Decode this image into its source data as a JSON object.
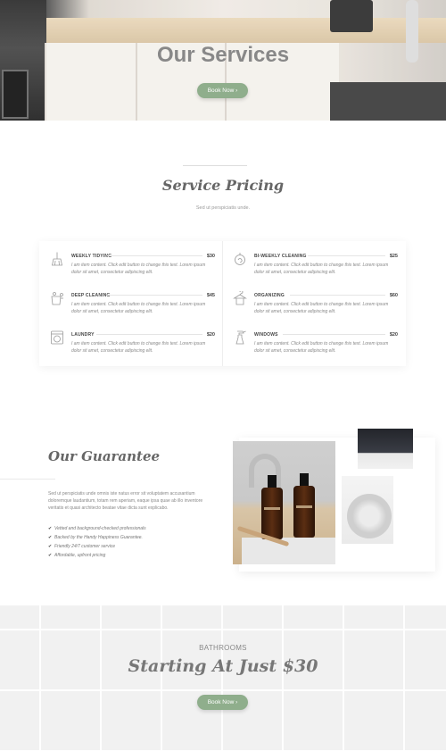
{
  "hero": {
    "title": "Our Services",
    "button_label": "Book Now  ›"
  },
  "pricing": {
    "title": "Service Pricing",
    "subtitle": "Sed ut perspiciatis unde.",
    "items": [
      {
        "name": "WEEKLY TIDYING",
        "price": "$30",
        "icon": "broom-icon",
        "desc": "I am item content. Click edit button to change this text. Lorem ipsum dolor sit amet, consectetur adipiscing elit."
      },
      {
        "name": "BI-WEEKLY CLEANING",
        "price": "$25",
        "icon": "cleaning-spray-icon",
        "desc": "I am item content. Click edit button to change this text. Lorem ipsum dolor sit amet, consectetur adipiscing elit."
      },
      {
        "name": "DEEP CLEANING",
        "price": "$45",
        "icon": "bucket-icon",
        "desc": "I am item content. Click edit button to change this text. Lorem ipsum dolor sit amet, consectetur adipiscing elit."
      },
      {
        "name": "ORGANIZING",
        "price": "$60",
        "icon": "hanger-shirt-icon",
        "desc": "I am item content. Click edit button to change this text. Lorem ipsum dolor sit amet, consectetur adipiscing elit."
      },
      {
        "name": "LAUNDRY",
        "price": "$20",
        "icon": "washing-machine-icon",
        "desc": "I am item content. Click edit button to change this text. Lorem ipsum dolor sit amet, consectetur adipiscing elit."
      },
      {
        "name": "WINDOWS",
        "price": "$20",
        "icon": "spray-bottle-icon",
        "desc": "I am item content. Click edit button to change this text. Lorem ipsum dolor sit amet, consectetur adipiscing elit."
      }
    ]
  },
  "guarantee": {
    "title": "Our Guarantee",
    "text": "Sed ut perspiciatis unde omnis iste natus error sit voluptatem accusantium doloremque laudantium, totam rem aperiam, eaque ipsa quae ab illo inventore veritatis et quasi architecto beatae vitae dicta sunt explicabo.",
    "list": [
      "Vetted and background-checked professionals",
      "Backed by the Handy Happiness Guarantee.",
      "Friendly 24/7 customer service",
      "Affordable, upfront pricing"
    ]
  },
  "bathrooms": {
    "label": "BATHROOMS",
    "title": "Starting At Just $30",
    "button_label": "Book Now  ›"
  },
  "colors": {
    "accent": "#8fae8c",
    "text": "#666666"
  }
}
